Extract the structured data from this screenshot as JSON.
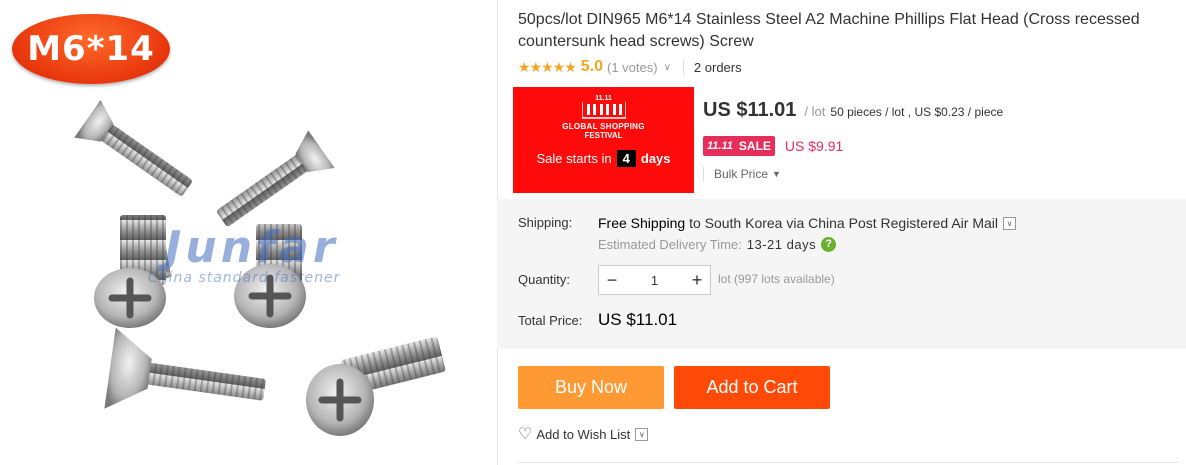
{
  "product_image": {
    "badge": "M6*14",
    "watermark": "Junfar",
    "watermark_sub": "China standard fastener"
  },
  "product": {
    "title": "50pcs/lot DIN965 M6*14 Stainless Steel A2 Machine Phillips Flat Head (Cross recessed countersunk head screws) Screw",
    "stars": "★★★★★",
    "rating_score": "5.0",
    "votes": "(1 votes)",
    "votes_chevron": "∨",
    "orders": "2 orders"
  },
  "promo": {
    "logo_text": "11.11",
    "festival_line1": "GLOBAL SHOPPING",
    "festival_line2": "FESTIVAL",
    "sale_starts_label": "Sale starts in",
    "days_number": "4",
    "days_label": "days",
    "background_color": "#ff0a0a"
  },
  "pricing": {
    "price": "US $11.01",
    "per_lot": "/ lot",
    "detail": "50 pieces / lot , US $0.23 / piece",
    "sale_tag_left": "11.11",
    "sale_tag_right": "SALE",
    "sale_price": "US $9.91",
    "bulk_label": "Bulk Price",
    "bulk_icon": "caret-down-icon",
    "sale_color": "#e62e5c"
  },
  "shipping": {
    "label": "Shipping:",
    "method_prefix": "Free Shipping",
    "method_suffix": "to South Korea via China Post Registered Air Mail",
    "dropdown_icon": "∨",
    "estimated_label": "Estimated Delivery Time:",
    "estimated_value": "13-21 days",
    "help_icon": "?"
  },
  "quantity": {
    "label": "Quantity:",
    "minus": "−",
    "value": "1",
    "plus": "+",
    "availability": "lot (997 lots available)"
  },
  "total": {
    "label": "Total Price:",
    "value": "US $11.01"
  },
  "actions": {
    "buy_now": "Buy Now",
    "add_to_cart": "Add to Cart",
    "wish_icon": "♡",
    "wish_label": "Add to Wish List",
    "wish_dropdown": "∨",
    "buy_color": "#ff9933",
    "cart_color": "#ff4b07"
  }
}
